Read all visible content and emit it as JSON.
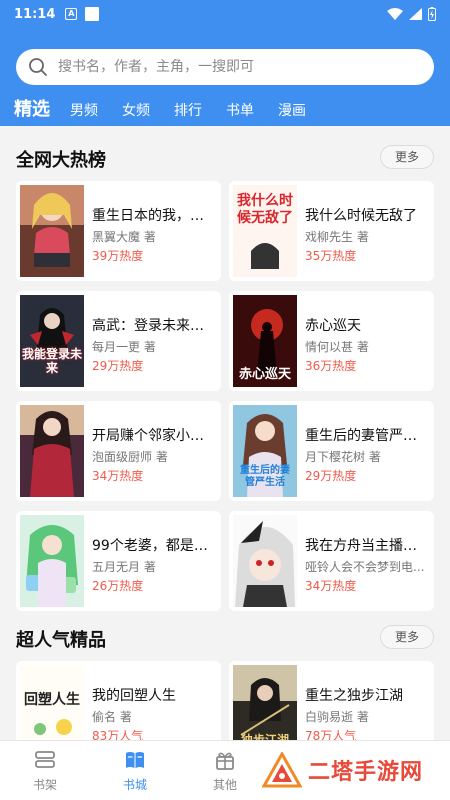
{
  "status": {
    "time": "11:14",
    "a_glyph": "A"
  },
  "search": {
    "placeholder": "搜书名，作者，主角，一搜即可"
  },
  "tabs": [
    {
      "label": "精选"
    },
    {
      "label": "男频"
    },
    {
      "label": "女频"
    },
    {
      "label": "排行"
    },
    {
      "label": "书单"
    },
    {
      "label": "漫画"
    }
  ],
  "sections": [
    {
      "title": "全网大热榜",
      "more": "更多",
      "books": [
        {
          "title": "重生日本的我，在...",
          "author": "黑翼大魔 著",
          "heat": "39万热度"
        },
        {
          "title": "我什么时候无敌了",
          "author": "戏柳先生 著",
          "heat": "35万热度",
          "cover_text": "我什么时候无敌了"
        },
        {
          "title": "高武：登录未来一...",
          "author": "每月一更 著",
          "heat": "29万热度",
          "cover_text": "我能登录未来"
        },
        {
          "title": "赤心巡天",
          "author": "情何以甚 著",
          "heat": "36万热度",
          "cover_text": "赤心巡天"
        },
        {
          "title": "开局赚个邻家小姐...",
          "author": "泡面级厨师 著",
          "heat": "34万热度"
        },
        {
          "title": "重生后的妻管严生...",
          "author": "月下樱花树 著",
          "heat": "29万热度",
          "cover_text": "重生后的妻管严生活"
        },
        {
          "title": "99个老婆，都是我...",
          "author": "五月无月 著",
          "heat": "26万热度"
        },
        {
          "title": "我在方舟当主播，...",
          "author": "哑铃人会不会梦到电...",
          "heat": "34万热度"
        }
      ]
    },
    {
      "title": "超人气精品",
      "more": "更多",
      "books": [
        {
          "title": "我的回塑人生",
          "author": "偷名 著",
          "heat": "83万人气",
          "cover_text": "回塑人生"
        },
        {
          "title": "重生之独步江湖",
          "author": "白驹易逝 著",
          "heat": "78万人气",
          "cover_text": "独步江湖"
        }
      ]
    }
  ],
  "bottom_nav": [
    {
      "label": "书架",
      "icon": "bookshelf-icon"
    },
    {
      "label": "书城",
      "icon": "book-city-icon"
    },
    {
      "label": "其他",
      "icon": "gift-icon"
    }
  ],
  "watermark": {
    "text": "二塔手游网"
  },
  "colors": {
    "accent": "#3f8ff0",
    "heat": "#f05a4a"
  }
}
